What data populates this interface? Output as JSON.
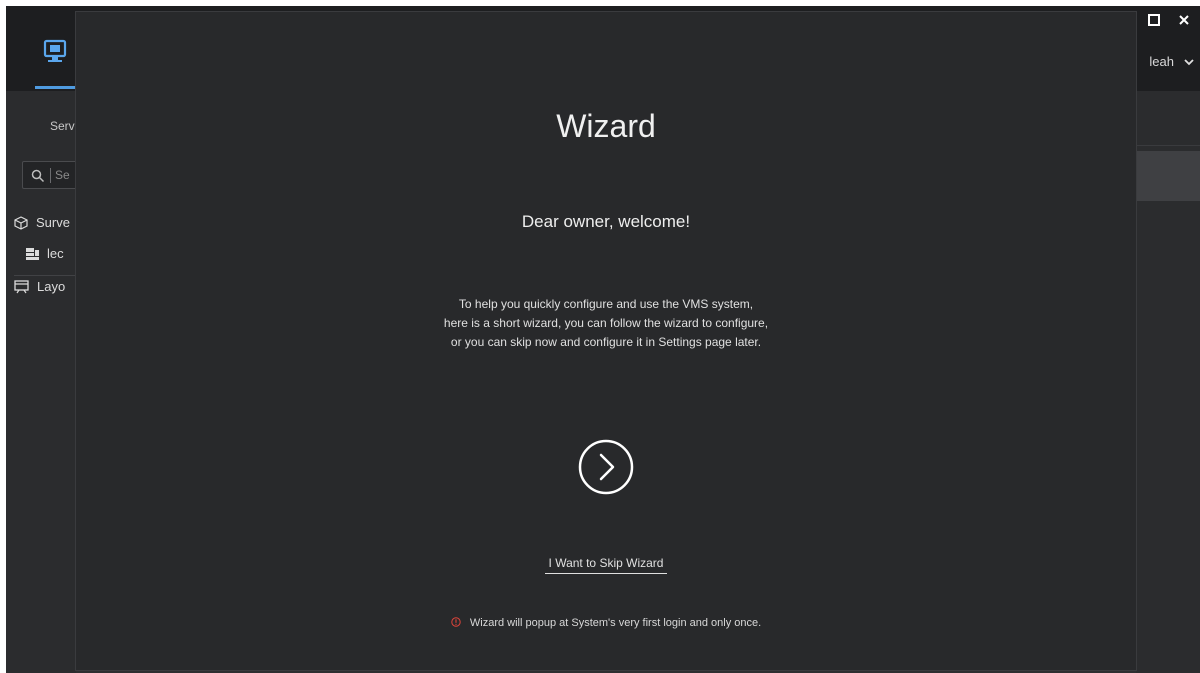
{
  "window": {
    "maximize_icon": "maximize-icon",
    "close_icon": "close-icon"
  },
  "topbar": {
    "monitor_tab_icon": "monitor-icon",
    "accent_color": "#4f9be0"
  },
  "user_menu": {
    "username": "leah",
    "chevron_icon": "chevron-down-icon"
  },
  "sidebar": {
    "tab_label": "Serv",
    "search_placeholder": "Se",
    "items": [
      {
        "label": "Surve",
        "icon": "cube-icon"
      },
      {
        "label": "lec",
        "icon": "server-icon"
      },
      {
        "label": "Layo",
        "icon": "layout-icon"
      }
    ]
  },
  "wizard": {
    "title": "Wizard",
    "greeting": "Dear owner, welcome!",
    "description": [
      "To help you quickly configure and use the VMS system,",
      "here is a short wizard, you can follow the wizard to configure,",
      "or you can skip now and configure it in Settings page later."
    ],
    "next_icon": "arrow-right-circle-icon",
    "skip_label": "I Want to Skip Wizard",
    "notice": "Wizard will popup at System's very first login and only once.",
    "notice_icon": "warning-icon",
    "notice_color": "#e0443a"
  }
}
